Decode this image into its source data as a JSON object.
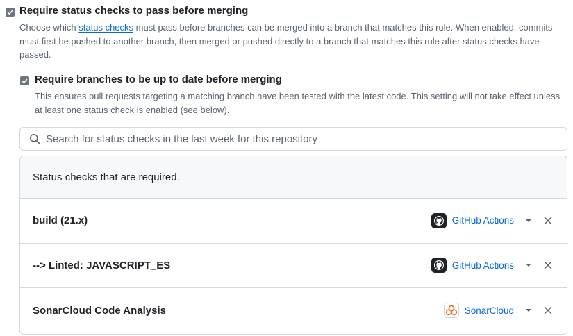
{
  "options": {
    "require_status_checks": {
      "title": "Require status checks to pass before merging",
      "desc_before": "Choose which ",
      "desc_link": "status checks",
      "desc_after": " must pass before branches can be merged into a branch that matches this rule. When enabled, commits must first be pushed to another branch, then merged or pushed directly to a branch that matches this rule after status checks have passed.",
      "checked": true
    },
    "require_up_to_date": {
      "title": "Require branches to be up to date before merging",
      "desc": "This ensures pull requests targeting a matching branch have been tested with the latest code. This setting will not take effect unless at least one status check is enabled (see below).",
      "checked": true
    }
  },
  "search": {
    "placeholder": "Search for status checks in the last week for this repository",
    "icon": "search-icon"
  },
  "checks": {
    "header": "Status checks that are required.",
    "rows": [
      {
        "name": "build (21.x)",
        "app": "GitHub Actions",
        "app_icon": "github-icon"
      },
      {
        "name": "--> Linted: JAVASCRIPT_ES",
        "app": "GitHub Actions",
        "app_icon": "github-icon"
      },
      {
        "name": "SonarCloud Code Analysis",
        "app": "SonarCloud",
        "app_icon": "sonarcloud-icon"
      }
    ]
  },
  "colors": {
    "link": "#0969da",
    "muted_text": "#59636e",
    "border": "#d1d9e0",
    "header_bg": "#f6f8fa",
    "sonarcloud": "#f3702a"
  }
}
